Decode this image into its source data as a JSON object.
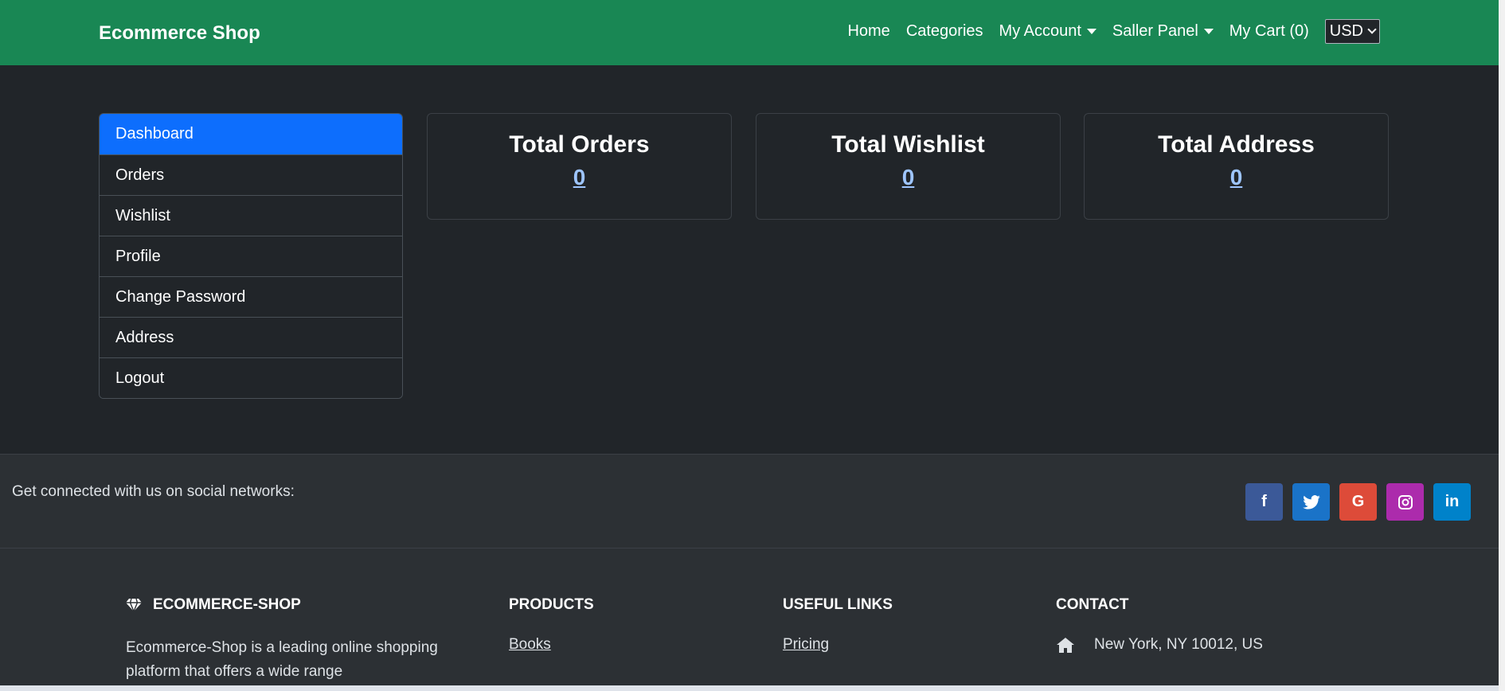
{
  "navbar": {
    "brand": "Ecommerce Shop",
    "links": [
      "Home",
      "Categories",
      "My Account",
      "Saller Panel",
      "My Cart (0)"
    ],
    "currency": "USD"
  },
  "sidebar": {
    "items": [
      "Dashboard",
      "Orders",
      "Wishlist",
      "Profile",
      "Change Password",
      "Address",
      "Logout"
    ]
  },
  "cards": [
    {
      "title": "Total Orders",
      "value": "0"
    },
    {
      "title": "Total Wishlist",
      "value": "0"
    },
    {
      "title": "Total Address",
      "value": "0"
    }
  ],
  "social": {
    "text": "Get connected with us on social networks:",
    "icons": [
      "facebook-icon",
      "twitter-icon",
      "google-icon",
      "instagram-icon",
      "linkedin-icon"
    ],
    "glyphs": [
      "f",
      "🐦",
      "G",
      "◎",
      "in"
    ],
    "colors": [
      "#3b5998",
      "#1a73c8",
      "#dd4b39",
      "#ac2bac",
      "#0082ca"
    ]
  },
  "footer": {
    "brand": "ECOMMERCE-SHOP",
    "description": "Ecommerce-Shop is a leading online shopping platform that offers a wide range",
    "products_title": "PRODUCTS",
    "products_link": "Books",
    "useful_title": "USEFUL LINKS",
    "useful_link": "Pricing",
    "contact_title": "CONTACT",
    "contact_address": "New York, NY 10012, US"
  }
}
